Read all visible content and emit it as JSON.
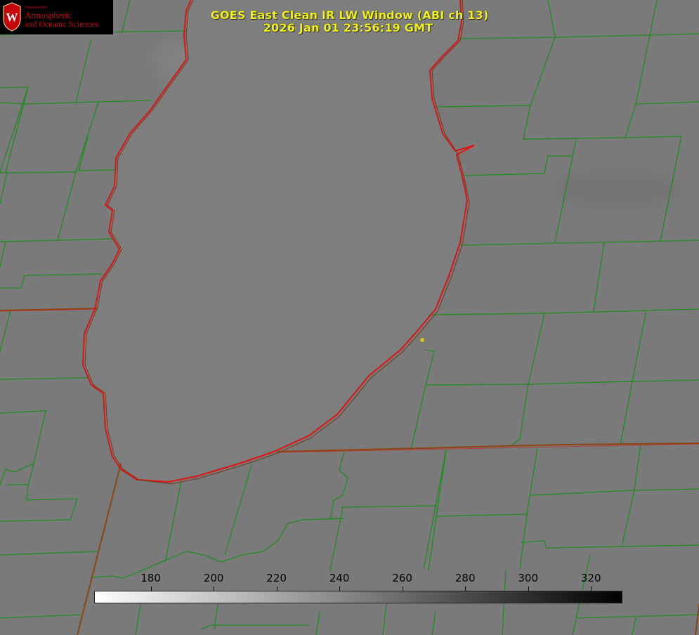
{
  "title": {
    "line1": "GOES East Clean IR LW Window (ABI ch 13)",
    "line2": "2026 Jan 01 23:56:19 GMT"
  },
  "logo": {
    "dept": "Department of",
    "line1": "Atmospheric",
    "line2": "and Oceanic Sciences",
    "crest_letter": "W"
  },
  "colorbar": {
    "ticks": [
      "180",
      "200",
      "220",
      "240",
      "260",
      "280",
      "300",
      "320"
    ],
    "range": [
      162,
      330
    ],
    "tick_values": [
      180,
      200,
      220,
      240,
      260,
      280,
      300,
      320
    ],
    "gradient": [
      "#ffffff",
      "#000000"
    ]
  },
  "colors": {
    "background": "#7c7c7c",
    "lake": "#7d7d7d",
    "county_lines": "#1e8c1e",
    "lake_shore": "#e01212",
    "state_lines": "#8b4513",
    "title": "#f2f21a",
    "marker": "#d6c21a"
  }
}
